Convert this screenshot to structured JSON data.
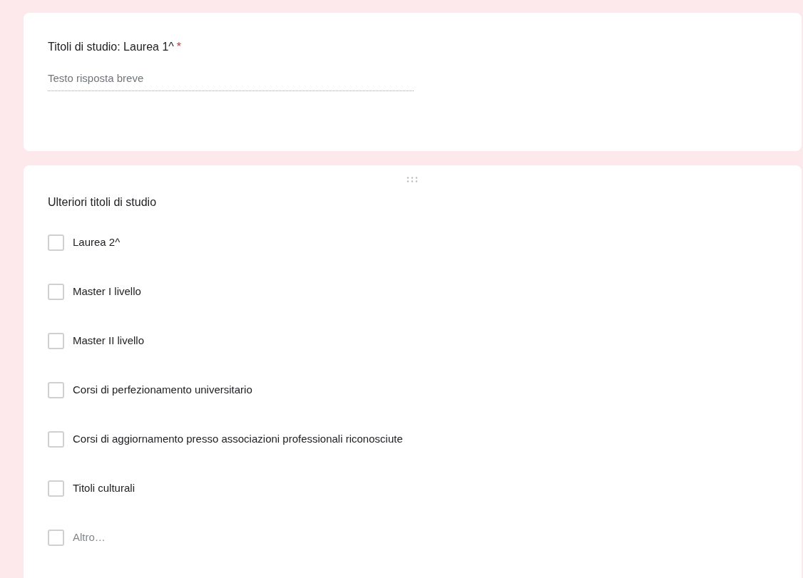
{
  "questions": [
    {
      "kind": "short_text",
      "title": "Titoli di studio: Laurea 1^",
      "required_mark": "*",
      "placeholder": "Testo risposta breve"
    },
    {
      "kind": "checkboxes",
      "title": "Ulteriori titoli di studio",
      "draggable": true,
      "options": [
        {
          "kind": "option",
          "label": "Laurea 2^",
          "checked": false
        },
        {
          "kind": "option",
          "label": "Master I livello",
          "checked": false
        },
        {
          "kind": "option",
          "label": "Master II livello",
          "checked": false
        },
        {
          "kind": "option",
          "label": "Corsi di perfezionamento universitario",
          "checked": false
        },
        {
          "kind": "option",
          "label": "Corsi di aggiornamento presso associazioni professionali riconosciute",
          "checked": false
        },
        {
          "kind": "option",
          "label": "Titoli culturali",
          "checked": false
        },
        {
          "kind": "other",
          "label": "Altro…",
          "checked": false
        }
      ]
    }
  ]
}
